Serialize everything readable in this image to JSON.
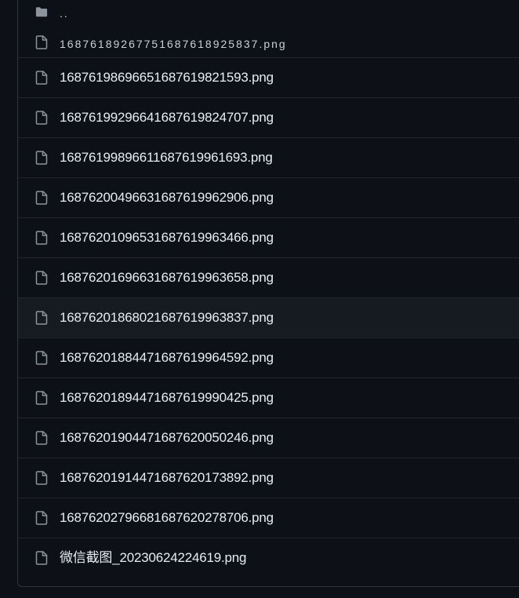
{
  "file_list": {
    "parent_dir": {
      "icon": "folder-icon",
      "label": ".."
    },
    "files": [
      {
        "icon": "file-icon",
        "name": "16876189267751687618925837.png"
      },
      {
        "icon": "file-icon",
        "name": "16876198696651687619821593.png"
      },
      {
        "icon": "file-icon",
        "name": "16876199296641687619824707.png"
      },
      {
        "icon": "file-icon",
        "name": "16876199896611687619961693.png"
      },
      {
        "icon": "file-icon",
        "name": "16876200496631687619962906.png"
      },
      {
        "icon": "file-icon",
        "name": "16876201096531687619963466.png"
      },
      {
        "icon": "file-icon",
        "name": "16876201696631687619963658.png"
      },
      {
        "icon": "file-icon",
        "name": "16876201868021687619963837.png"
      },
      {
        "icon": "file-icon",
        "name": "16876201884471687619964592.png"
      },
      {
        "icon": "file-icon",
        "name": "16876201894471687619990425.png"
      },
      {
        "icon": "file-icon",
        "name": "16876201904471687620050246.png"
      },
      {
        "icon": "file-icon",
        "name": "16876201914471687620173892.png"
      },
      {
        "icon": "file-icon",
        "name": "16876202796681687620278706.png"
      },
      {
        "icon": "file-icon",
        "name": "微信截图_20230624224619.png"
      }
    ]
  },
  "colors": {
    "background": "#0d1117",
    "border": "#21262d",
    "hover_row": "#161b22",
    "text": "#e6edf3",
    "icon": "#8b949e"
  }
}
